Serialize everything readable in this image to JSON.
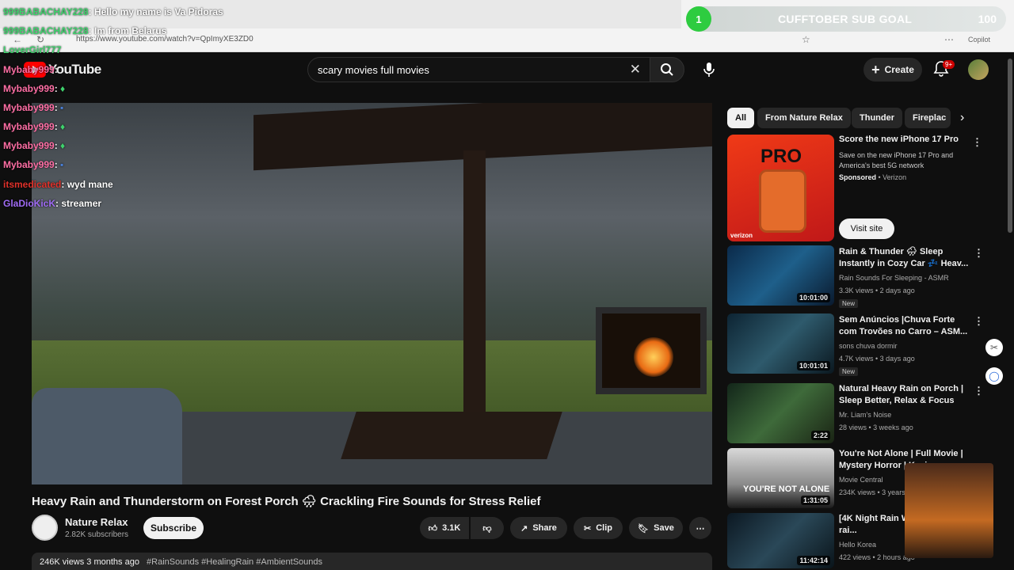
{
  "browser": {
    "url": "https://www.youtube.com/watch?v=QpImyXE3ZD0",
    "copilot_label": "Copilot"
  },
  "sub_goal": {
    "count": "1",
    "label": "CUFFTOBER SUB GOAL",
    "target": "100",
    "progress_fraction": 0.01
  },
  "youtube": {
    "logo_text": "YouTube",
    "search_value": "scary movies full movies",
    "create_label": "Create",
    "notif_badge": "9+"
  },
  "video": {
    "title": "Heavy Rain and Thunderstorm on Forest Porch 🌧 Crackling Fire Sounds for Stress Relief",
    "channel": "Nature Relax",
    "subscribers": "2.82K subscribers",
    "subscribe_label": "Subscribe",
    "likes": "3.1K",
    "share_label": "Share",
    "clip_label": "Clip",
    "save_label": "Save",
    "views_age": "246K views  3 months ago",
    "tags": "#RainSounds #HealingRain #AmbientSounds"
  },
  "chips": [
    "All",
    "From Nature Relax",
    "Thunder",
    "Fireplac"
  ],
  "ad": {
    "title": "Score the new iPhone 17 Pro",
    "description": "Save on the new iPhone 17 Pro and America's best 5G network",
    "sponsored": "Sponsored",
    "advertiser": "Verizon",
    "visit_label": "Visit site",
    "thumb_pro": "PRO",
    "thumb_brand": "verizon"
  },
  "related": [
    {
      "title": "Rain & Thunder 🌧 Sleep Instantly in Cozy Car 💤 Heav...",
      "channel": "Rain Sounds For Sleeping - ASMR",
      "meta": "3.3K views • 2 days ago",
      "badge": "New",
      "duration": "10:01:00"
    },
    {
      "title": "Sem Anúncios |Chuva Forte com Trovões no Carro – ASM...",
      "channel": "sons chuva dormir",
      "meta": "4.7K views • 3 days ago",
      "badge": "New",
      "duration": "10:01:01"
    },
    {
      "title": "Natural Heavy Rain on Porch | Sleep Better, Relax & Focus All...",
      "channel": "Mr. Liam's Noise",
      "meta": "28 views • 3 weeks ago",
      "badge": "",
      "duration": "2:22"
    },
    {
      "title": "You're Not Alone | Full Movie | Mystery Horror | Kasia...",
      "channel": "Movie Central",
      "meta": "234K views • 3 years ago",
      "badge": "",
      "duration": "1:31:05",
      "thumb_text": "YOU'RE NOT ALONE"
    },
    {
      "title": "[4K Night Rain W... poem told by rai...",
      "channel": "Hello Korea",
      "meta": "422 views • 2 hours ago",
      "badge": "",
      "duration": "11:42:14"
    }
  ],
  "chat": [
    {
      "user": "999BABACHAY228",
      "msg": ": Hello my name is Va Pidoras",
      "color": "#3fd16d"
    },
    {
      "user": "999BABACHAY228",
      "msg": ": Im from Belarus",
      "color": "#3fd16d"
    },
    {
      "user": "LoverGirl777",
      "msg": "",
      "color": "#3fd16d"
    },
    {
      "user": "Mybaby999",
      "msg": ":",
      "color": "#ff6fa5"
    },
    {
      "user": "Mybaby999",
      "msg": ":",
      "color": "#ff6fa5"
    },
    {
      "user": "Mybaby999",
      "msg": ":",
      "color": "#ff6fa5"
    },
    {
      "user": "Mybaby999",
      "msg": ":",
      "color": "#ff6fa5"
    },
    {
      "user": "Mybaby999",
      "msg": ":",
      "color": "#ff6fa5"
    },
    {
      "user": "Mybaby999",
      "msg": ":",
      "color": "#ff6fa5"
    },
    {
      "user": "itsmedicated",
      "msg": ": wyd mane",
      "color": "#e0312a"
    },
    {
      "user": "GlaDioKicK",
      "msg": ":  streamer",
      "color": "#a06cf5"
    }
  ]
}
